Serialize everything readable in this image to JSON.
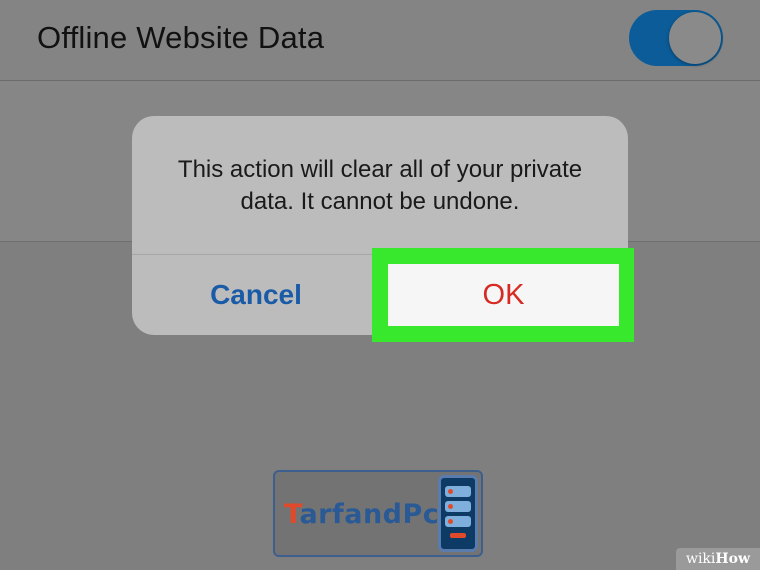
{
  "settings": {
    "offline_website_data": {
      "label": "Offline Website Data",
      "enabled": true
    }
  },
  "alert": {
    "message": "This action will clear all of your private data. It cannot be undone.",
    "cancel_label": "Cancel",
    "ok_label": "OK"
  },
  "watermark": {
    "brand_initial": "T",
    "brand_rest": "arfandPc"
  },
  "badge": {
    "wiki": "wiki",
    "how": "How"
  },
  "colors": {
    "toggle_on": "#0b5c98",
    "cancel_text": "#1a5ba8",
    "ok_text": "#d62a23",
    "highlight": "#38e82c"
  },
  "icons": {
    "watermark_graphic": "phone-icon"
  }
}
